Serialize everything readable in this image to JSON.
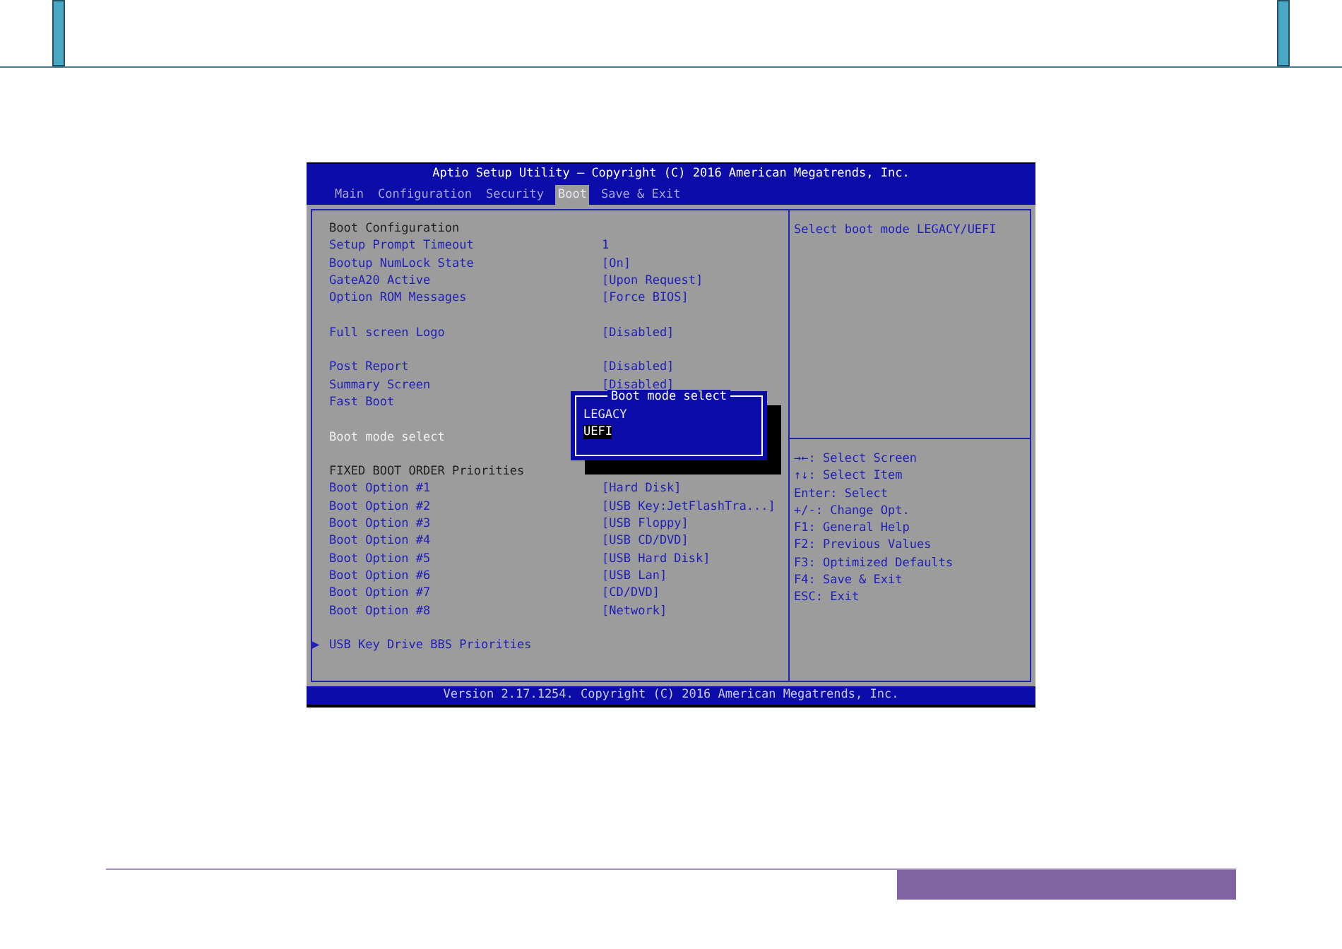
{
  "bios": {
    "title": "Aptio Setup Utility – Copyright (C) 2016 American Megatrends, Inc.",
    "tabs": [
      {
        "label": "Main",
        "selected": false
      },
      {
        "label": "Configuration",
        "selected": false
      },
      {
        "label": "Security",
        "selected": false
      },
      {
        "label": "Boot",
        "selected": true
      },
      {
        "label": "Save & Exit",
        "selected": false
      }
    ],
    "items": [
      {
        "kind": "header",
        "label": "Boot Configuration",
        "gap_before": false
      },
      {
        "kind": "setting",
        "label": "Setup Prompt Timeout",
        "value": "1",
        "gap_before": false
      },
      {
        "kind": "setting",
        "label": "Bootup NumLock State",
        "value": "[On]",
        "gap_before": false
      },
      {
        "kind": "setting",
        "label": "GateA20 Active",
        "value": "[Upon Request]",
        "gap_before": false
      },
      {
        "kind": "setting",
        "label": "Option ROM Messages",
        "value": "[Force BIOS]",
        "gap_before": false
      },
      {
        "kind": "setting",
        "label": "Full screen Logo",
        "value": "[Disabled]",
        "gap_before": true
      },
      {
        "kind": "setting",
        "label": "Post Report",
        "value": "[Disabled]",
        "gap_before": true
      },
      {
        "kind": "setting",
        "label": "Summary Screen",
        "value": "[Disabled]",
        "gap_before": false
      },
      {
        "kind": "setting",
        "label": "Fast Boot",
        "gap_before": false
      },
      {
        "kind": "active",
        "label": "Boot mode select",
        "gap_before": true
      },
      {
        "kind": "header",
        "label": "FIXED BOOT ORDER Priorities",
        "gap_before": true
      },
      {
        "kind": "setting",
        "label": "Boot Option #1",
        "value": "[Hard Disk]",
        "gap_before": false
      },
      {
        "kind": "setting",
        "label": "Boot Option #2",
        "value": "[USB Key:JetFlashTra...]",
        "gap_before": false
      },
      {
        "kind": "setting",
        "label": "Boot Option #3",
        "value": "[USB Floppy]",
        "gap_before": false
      },
      {
        "kind": "setting",
        "label": "Boot Option #4",
        "value": "[USB CD/DVD]",
        "gap_before": false
      },
      {
        "kind": "setting",
        "label": "Boot Option #5",
        "value": "[USB Hard Disk]",
        "gap_before": false
      },
      {
        "kind": "setting",
        "label": "Boot Option #6",
        "value": "[USB Lan]",
        "gap_before": false
      },
      {
        "kind": "setting",
        "label": "Boot Option #7",
        "value": "[CD/DVD]",
        "gap_before": false
      },
      {
        "kind": "setting",
        "label": "Boot Option #8",
        "value": "[Network]",
        "gap_before": false
      },
      {
        "kind": "submenu",
        "marker": "▶",
        "label": "USB Key Drive BBS Priorities",
        "gap_before": true
      }
    ],
    "popup": {
      "title": "Boot mode select",
      "options": [
        {
          "label": "LEGACY",
          "selected": false
        },
        {
          "label": "UEFI",
          "selected": true
        }
      ]
    },
    "help": "Select boot mode LEGACY/UEFI",
    "keys": [
      "→←: Select Screen",
      "↑↓: Select Item",
      "Enter: Select",
      "+/-: Change Opt.",
      "F1: General Help",
      "F2: Previous Values",
      "F3: Optimized Defaults",
      "F4: Save & Exit",
      "ESC: Exit"
    ],
    "footer": "Version 2.17.1254. Copyright (C) 2016 American Megatrends, Inc."
  }
}
